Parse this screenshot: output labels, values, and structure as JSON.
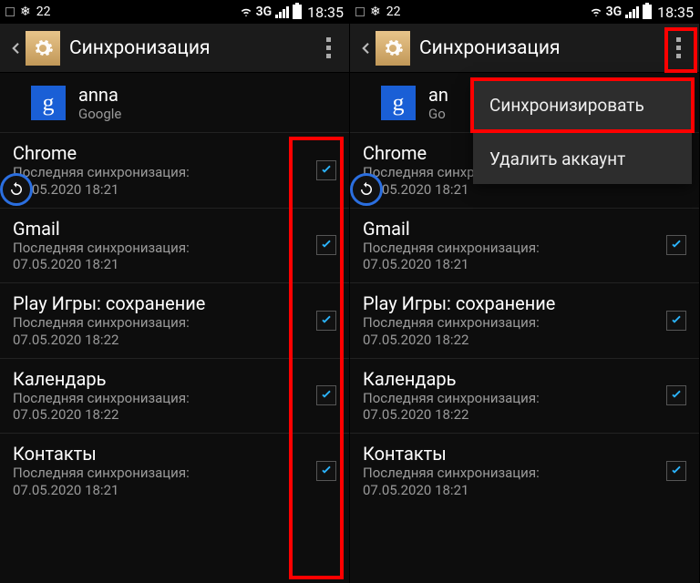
{
  "status": {
    "temp": "22",
    "net": "3G",
    "time": "18:35"
  },
  "appbar": {
    "title": "Синхронизация"
  },
  "account": {
    "name_full": "anna",
    "name_clip": "an",
    "provider": "Google",
    "provider_clip": "Go",
    "g": "g"
  },
  "sync_label": "Последняя синхронизация:",
  "items": [
    {
      "title": "Chrome",
      "ts": "07.05.2020 18:21"
    },
    {
      "title": "Gmail",
      "ts": "07.05.2020 18:21"
    },
    {
      "title": "Play Игры: сохранение",
      "ts": "07.05.2020 18:22"
    },
    {
      "title": "Календарь",
      "ts": "07.05.2020 18:22"
    },
    {
      "title": "Контакты",
      "ts": "07.05.2020 18:21"
    }
  ],
  "popup": {
    "sync_now": "Синхронизировать",
    "remove": "Удалить аккаунт"
  }
}
